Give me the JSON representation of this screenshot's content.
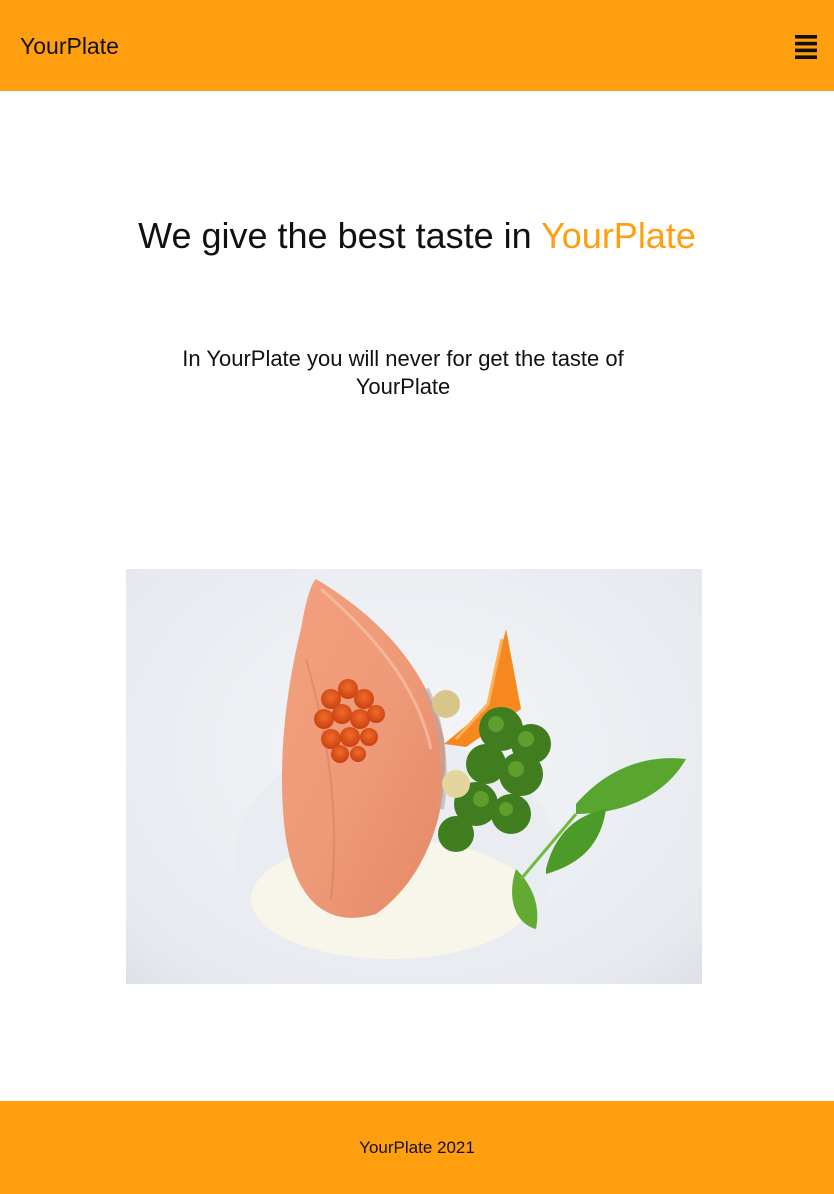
{
  "header": {
    "brand": "YourPlate",
    "menu_icon": "hamburger-menu-icon"
  },
  "hero": {
    "title_prefix": "We give the best taste in ",
    "title_highlight": "YourPlate",
    "subtitle": "In YourPlate you will never for get the taste of YourPlate"
  },
  "image": {
    "subject": "salmon-dish-photo"
  },
  "footer": {
    "text": "YourPlate 2021"
  },
  "colors": {
    "accent": "#ff9f10",
    "text": "#111111",
    "background": "#ffffff"
  }
}
